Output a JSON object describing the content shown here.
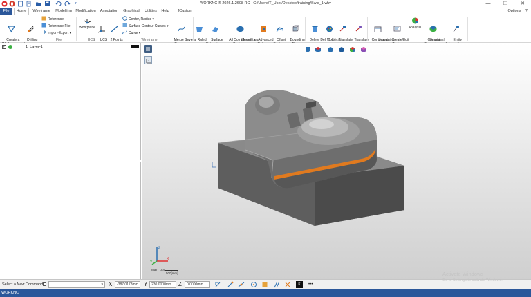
{
  "titlebar": {
    "title": "WORKNC ® 2026.1.2608 RC - C:/Users/T_User/Desktop/training/Swis_1.wkv",
    "minimize": "—",
    "maximize": "❐",
    "close": "✕",
    "options_label": "Options ▾",
    "help_icon": "?"
  },
  "menu": {
    "tabs": [
      "File",
      "Home",
      "Wireframe",
      "Modelling",
      "Modification",
      "Annotation",
      "Graphical",
      "Utilities",
      "Help",
      "[Custom Tab]"
    ],
    "active": "Home"
  },
  "ribbon": {
    "groups": [
      "File",
      "UCS",
      "Wireframe",
      "Modelling",
      "Modification",
      "Annotation",
      "Graphical"
    ],
    "buttons": {
      "create_workzone": "Create a\nWorkzone ▾",
      "drilling_manager": "Drilling\nManager",
      "reference": "Reference",
      "reference_file": "Reference File",
      "import_export": "Import-Export ▾",
      "workplane": "Workplane",
      "ucs": "UCS\n▾",
      "two_points": "2 Points\n▾",
      "center_radius": "Center, Radius ▾",
      "surface_contour_curves": "Surface Contour Curves ▾",
      "curve": "Curve ▾",
      "merge_several_curves": "Merge Several\nCurves ▾",
      "ruled": "Ruled\n▾",
      "surface_extension": "Surface\nExtension ▾",
      "all_complementary_surfaces": "All Complementary\nSurfaces",
      "advanced_cutter": "Advanced\nCutter ▾",
      "offset_surface": "Offset\nSurface",
      "bounding_box": "Bounding\nBox",
      "delete_del": "Delete Del\n▾",
      "color": "Color\n▾",
      "translate1": "Translate\n▾",
      "translate2": "Translate\n▾",
      "continuous": "Continuous\n▾",
      "create_edit_text": "Create/Edit\nText ▾",
      "analysis": "Analysis",
      "compare_geometry": "Compare\nGeometry ▾",
      "entity_information": "Entity\nInformation ▾"
    }
  },
  "layers": {
    "items": [
      {
        "label": "1: Layer-1",
        "checked": true
      }
    ]
  },
  "viewport": {
    "triad_label": "main_ucs",
    "scale_label": "500[mm]",
    "axes": {
      "x": "X",
      "y": "Y",
      "z": "Z"
    }
  },
  "cmdbar": {
    "command_placeholder": "Select a New Command...",
    "x_label": "X",
    "x_value": "-387.0178mm",
    "y_label": "Y",
    "y_value": "230.0000mm",
    "z_label": "Z",
    "z_value": "0.0000mm",
    "more": "•••"
  },
  "watermark": {
    "line1": "Activate Windows",
    "line2": "Go to Settings to activate Windows."
  },
  "status": {
    "text": "WORKNC"
  },
  "colors": {
    "file_tab": "#2b579a",
    "status_bar": "#2b579a",
    "highlight_orange": "#e07a1f"
  }
}
